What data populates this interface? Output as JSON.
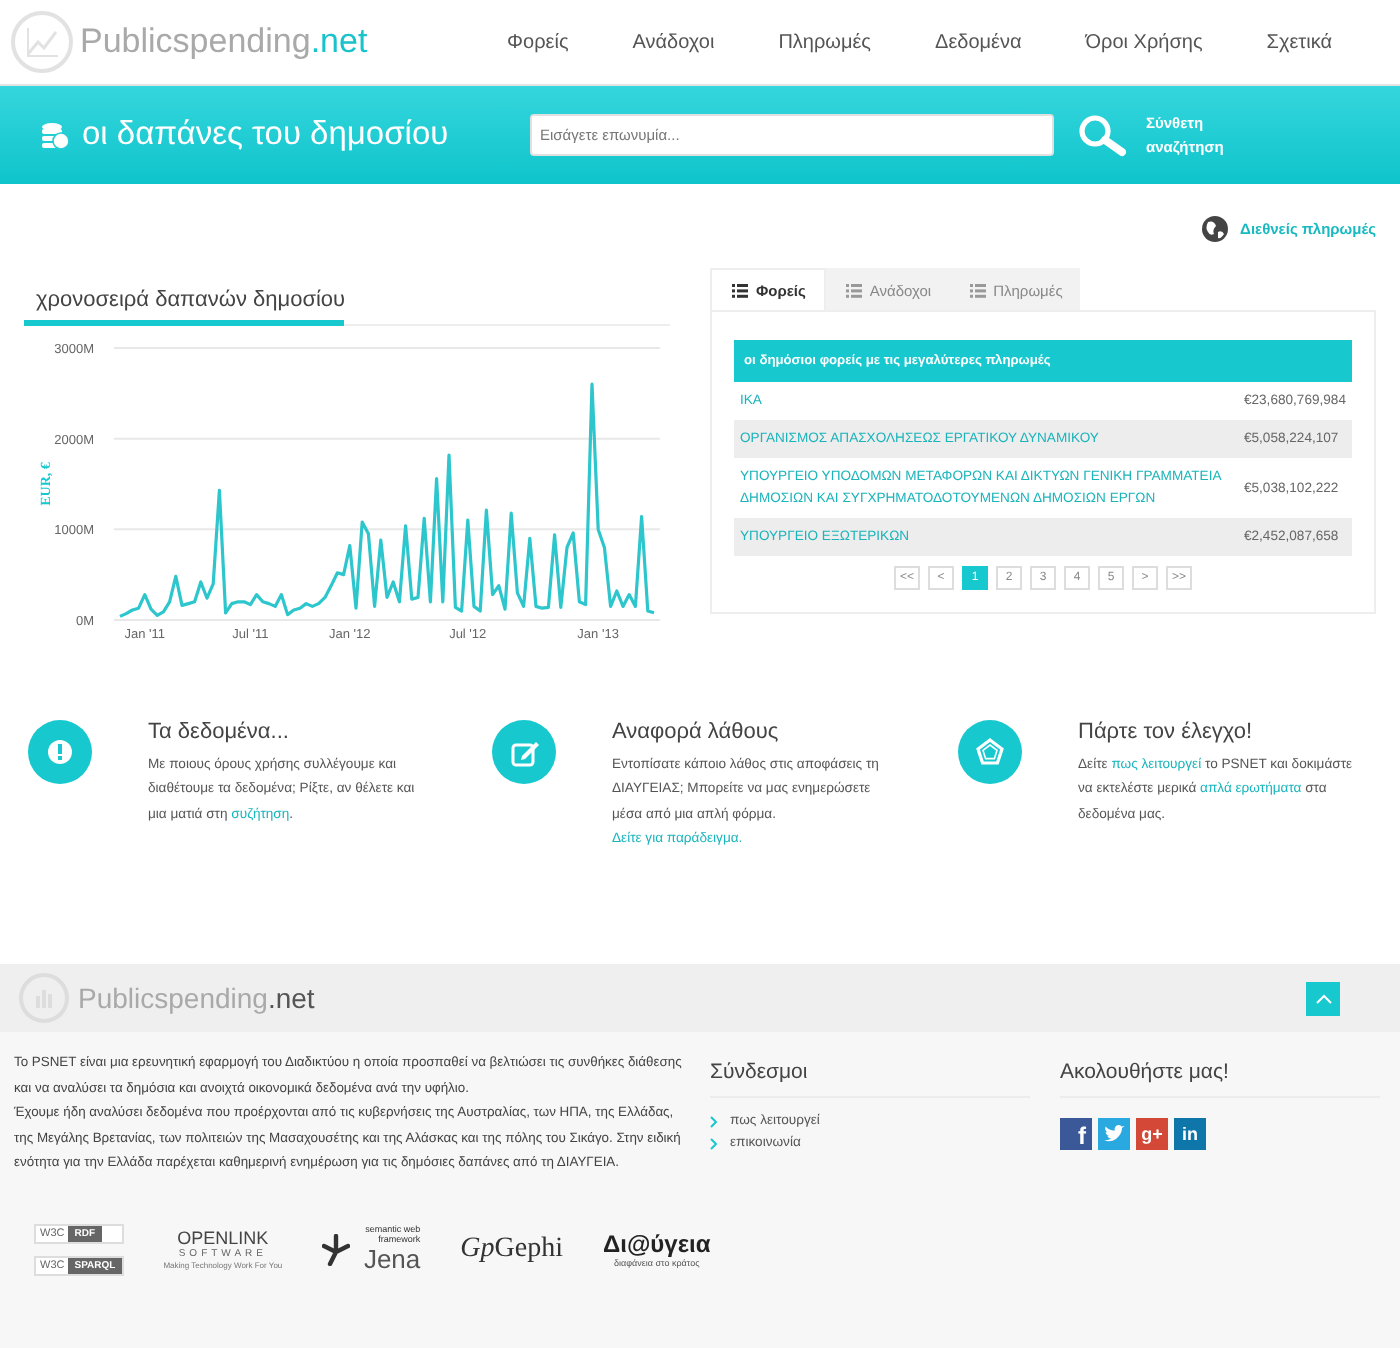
{
  "header": {
    "site_name": "Publicspending",
    "site_suffix": ".net",
    "nav": [
      {
        "label": "Φορείς"
      },
      {
        "label": "Ανάδοχοι"
      },
      {
        "label": "Πληρωμές"
      },
      {
        "label": "Δεδομένα"
      },
      {
        "label": "Όροι Χρήσης"
      },
      {
        "label": "Σχετικά"
      }
    ]
  },
  "banner": {
    "title": "οι δαπάνες του δημοσίου",
    "search": {
      "placeholder": "Εισάγετε επωνυμία..."
    },
    "advanced_link": "Σύνθετη αναζήτηση"
  },
  "international_link": "Διεθνείς πληρωμές",
  "timeseries": {
    "chart_data": {
      "type": "line",
      "title": "χρονοσειρά δαπανών δημοσίου",
      "ylabel": "EUR, €",
      "categories": [
        null,
        null,
        null,
        null,
        "Jan '11",
        null,
        null,
        null,
        null,
        null,
        null,
        null,
        null,
        null,
        null,
        null,
        null,
        null,
        null,
        null,
        null,
        "Jul '11",
        null,
        null,
        null,
        null,
        null,
        null,
        null,
        null,
        null,
        null,
        null,
        null,
        null,
        null,
        null,
        "Jan '12",
        null,
        null,
        null,
        null,
        null,
        null,
        null,
        null,
        null,
        null,
        null,
        null,
        null,
        null,
        null,
        null,
        null,
        null,
        "Jul '12",
        null,
        null,
        null,
        null,
        null,
        null,
        null,
        null,
        null,
        null,
        null,
        null,
        null,
        null,
        null,
        null,
        null,
        null,
        null,
        null,
        "Jan '13",
        null,
        null,
        null,
        null,
        null,
        null,
        null,
        null,
        null
      ],
      "values": [
        40,
        70,
        110,
        130,
        280,
        120,
        50,
        90,
        200,
        480,
        160,
        180,
        200,
        420,
        240,
        400,
        1430,
        80,
        180,
        200,
        200,
        170,
        280,
        200,
        180,
        150,
        280,
        60,
        110,
        130,
        180,
        150,
        180,
        250,
        380,
        520,
        500,
        820,
        130,
        1080,
        950,
        150,
        880,
        250,
        420,
        200,
        1040,
        230,
        250,
        1120,
        200,
        1560,
        200,
        1820,
        140,
        100,
        1100,
        150,
        100,
        1210,
        280,
        380,
        120,
        1180,
        300,
        150,
        900,
        150,
        130,
        140,
        940,
        140,
        800,
        960,
        200,
        170,
        2600,
        1000,
        800,
        150,
        320,
        150,
        280,
        150,
        1140,
        100,
        80
      ],
      "ylim": [
        0,
        3000
      ],
      "yticks": [
        {
          "value": 0,
          "label": "0M"
        },
        {
          "value": 1000,
          "label": "1000M"
        },
        {
          "value": 2000,
          "label": "2000M"
        },
        {
          "value": 3000,
          "label": "3000M"
        }
      ]
    }
  },
  "ranking": {
    "tabs": [
      {
        "label": "Φορείς",
        "selected": true
      },
      {
        "label": "Ανάδοχοι",
        "selected": false
      },
      {
        "label": "Πληρωμές",
        "selected": false
      }
    ],
    "table_title": "οι δημόσιοι φορείς με τις μεγαλύτερες πληρωμές",
    "rows": [
      {
        "name": "ΙΚΑ",
        "amount": "€23,680,769,984"
      },
      {
        "name": "ΟΡΓΑΝΙΣΜΟΣ ΑΠΑΣΧΟΛΗΣΕΩΣ ΕΡΓΑΤΙΚΟΥ ΔΥΝΑΜΙΚΟΥ",
        "amount": "€5,058,224,107"
      },
      {
        "name": "ΥΠΟΥΡΓΕΙΟ ΥΠΟΔΟΜΩΝ ΜΕΤΑΦΟΡΩΝ ΚΑΙ ΔΙΚΤΥΩΝ ΓΕΝΙΚΗ ΓΡΑΜΜΑΤΕΙΑ ΔΗΜΟΣΙΩΝ ΚΑΙ ΣΥΓΧΡΗΜΑΤΟΔΟΤΟΥΜΕΝΩΝ ΔΗΜΟΣΙΩΝ ΕΡΓΩΝ",
        "amount": "€5,038,102,222"
      },
      {
        "name": "ΥΠΟΥΡΓΕΙΟ ΕΞΩΤΕΡΙΚΩΝ",
        "amount": "€2,452,087,658"
      }
    ],
    "pagination": [
      {
        "label": "<<",
        "selected": false
      },
      {
        "label": "<",
        "selected": false
      },
      {
        "label": "1",
        "selected": true
      },
      {
        "label": "2",
        "selected": false
      },
      {
        "label": "3",
        "selected": false
      },
      {
        "label": "4",
        "selected": false
      },
      {
        "label": "5",
        "selected": false
      },
      {
        "label": ">",
        "selected": false
      },
      {
        "label": ">>",
        "selected": false
      }
    ]
  },
  "features": [
    {
      "kind": "alert",
      "title": "Τα δεδομένα...",
      "text": [
        {
          "text": "Με ποιους όρους χρήσης συλλέγουμε και διαθέτουμε τα δεδομένα; Ρίξτε, αν θέλετε και μια ματιά στη "
        },
        {
          "text": "συζήτηση",
          "link": true
        },
        {
          "text": "."
        }
      ]
    },
    {
      "kind": "edit",
      "title": "Αναφορά λάθους",
      "text": [
        {
          "text": "Εντοπίσατε κάποιο λάθος στις αποφάσεις τη ΔΙΑΥΓΕΙΑΣ; Μπορείτε να μας ενημερώσετε μέσα από μια απλή φόρμα."
        }
      ],
      "more_link": "Δείτε για παράδειγμα."
    },
    {
      "kind": "pentagon",
      "title": "Πάρτε τον έλεγχο!",
      "text": [
        {
          "text": "Δείτε "
        },
        {
          "text": "πως λειτουργεί",
          "link": true
        },
        {
          "text": " το PSNET και δοκιμάστε να εκτελέστε μερικά "
        },
        {
          "text": "απλά ερωτήματα",
          "link": true
        },
        {
          "text": " στα δεδομένα μας."
        }
      ]
    }
  ],
  "footer": {
    "site_name": "Publicspending",
    "site_suffix": ".net",
    "about": [
      "Το PSNET είναι μια ερευνητική εφαρμογή του Διαδικτύου η οποία προσπαθεί να βελτιώσει τις συνθήκες διάθεσης και να αναλύσει τα δημόσια και ανοιχτά οικονομικά δεδομένα ανά την υφήλιο.",
      "Έχουμε ήδη αναλύσει δεδομένα που προέρχονται από τις κυβερνήσεις της Αυστραλίας, των ΗΠΑ, της Ελλάδας, της Μεγάλης Βρετανίας, των πολιτειών της Μασαχουσέτης και της Αλάσκας και της πόλης του Σικάγο. Στην ειδική ενότητα για την Ελλάδα παρέχεται καθημερινή ενημέρωση για τις δημόσιες δαπάνες από τη ΔΙΑΥΓΕΙΑ."
    ],
    "links_title": "Σύνδεσμοι",
    "links": [
      {
        "label": "πως λειτουργεί"
      },
      {
        "label": "επικοινωνία"
      }
    ],
    "social_title": "Ακολουθήστε μας!",
    "social": [
      {
        "kind": "facebook",
        "glyph": "f"
      },
      {
        "kind": "twitter"
      },
      {
        "kind": "googleplus",
        "glyph": "g+"
      },
      {
        "kind": "linkedin",
        "glyph": "in"
      }
    ],
    "partners": [
      {
        "kind": "w3c",
        "mark": "W3C",
        "label": "RDF"
      },
      {
        "kind": "w3c",
        "mark": "W3C",
        "label": "SPARQL"
      },
      {
        "kind": "openlink",
        "name": "OPENLINK",
        "sub": "SOFTWARE",
        "tagline": "Making Technology Work For You"
      },
      {
        "kind": "jena",
        "name": "Jena",
        "sub": "semantic web framework"
      },
      {
        "kind": "gephi",
        "mark": "Gp",
        "name": "Gephi"
      },
      {
        "kind": "diavgeia",
        "name": "Δι@ύγεια",
        "sub": "διαφάνεια στο κράτος"
      }
    ]
  }
}
